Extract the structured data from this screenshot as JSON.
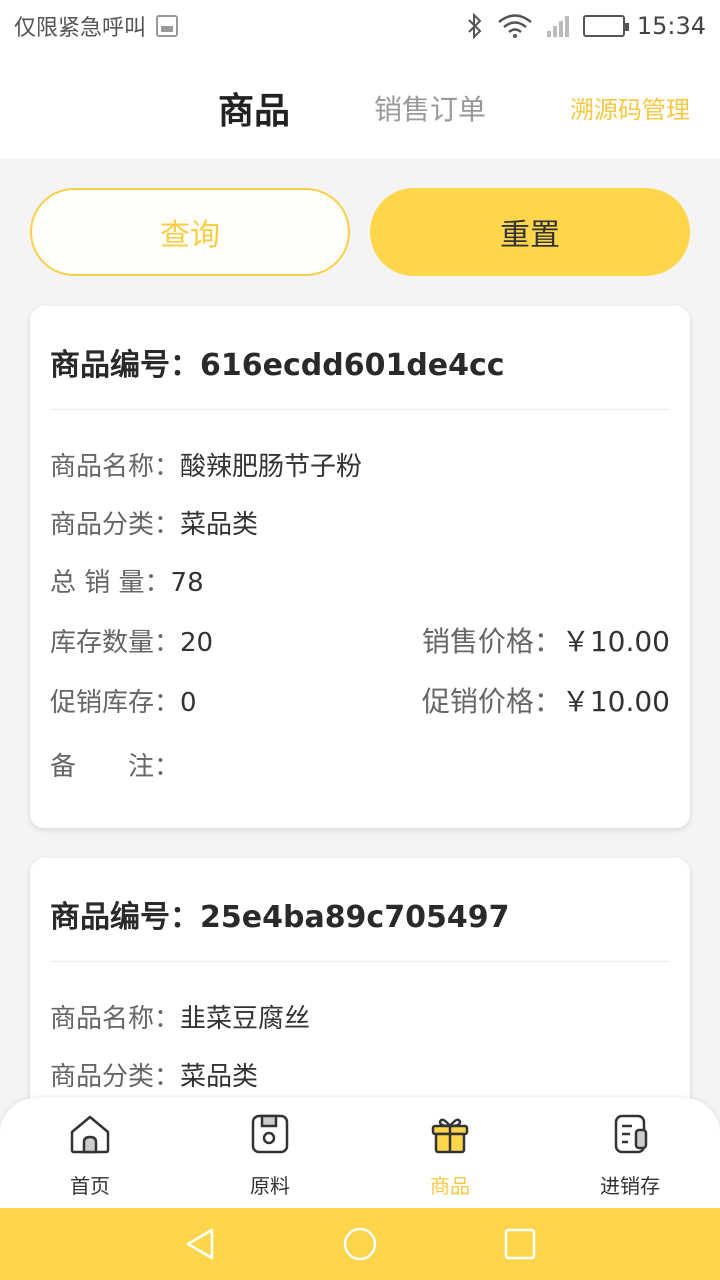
{
  "status_bar": {
    "carrier": "仅限紧急呼叫",
    "time": "15:34",
    "icons": [
      "image-icon",
      "bluetooth-icon",
      "wifi-icon",
      "signal-icon",
      "battery-icon"
    ]
  },
  "header": {
    "tabs": [
      {
        "label": "商品"
      },
      {
        "label": "销售订单"
      },
      {
        "label": "溯源码管理"
      }
    ]
  },
  "actions": {
    "query_label": "查询",
    "reset_label": "重置"
  },
  "products": [
    {
      "code_label": "商品编号：",
      "code": "616ecdd601de4cc",
      "name_label": "商品名称：",
      "name": "酸辣肥肠节子粉",
      "category_label": "商品分类：",
      "category": "菜品类",
      "sales_label": "总 销 量：",
      "sales": "78",
      "stock_label": "库存数量：",
      "stock": "20",
      "price_label": "销售价格：",
      "price": "￥10.00",
      "promo_stock_label": "促销库存：",
      "promo_stock": "0",
      "promo_price_label": "促销价格：",
      "promo_price": "￥10.00",
      "remark_label": "备　　注：",
      "remark": ""
    },
    {
      "code_label": "商品编号：",
      "code": "25e4ba89c705497",
      "name_label": "商品名称：",
      "name": "韭菜豆腐丝",
      "category_label": "商品分类：",
      "category": "菜品类"
    }
  ],
  "bottom_nav": [
    {
      "label": "首页",
      "icon": "home-icon"
    },
    {
      "label": "原料",
      "icon": "material-icon"
    },
    {
      "label": "商品",
      "icon": "gift-icon",
      "active": true
    },
    {
      "label": "进销存",
      "icon": "inventory-icon"
    }
  ],
  "colors": {
    "accent": "#fdd64b",
    "accent_text": "#f5c842"
  }
}
